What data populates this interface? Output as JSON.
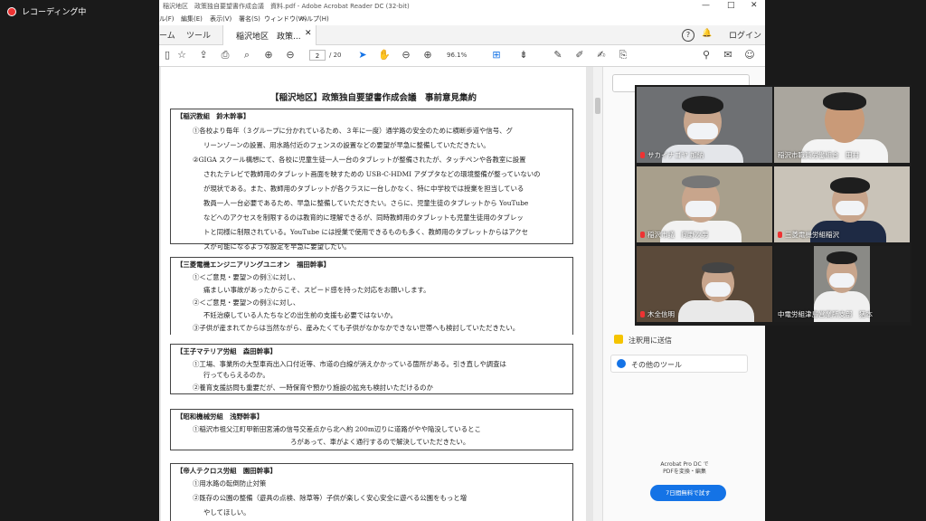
{
  "recording": {
    "label": "レコーディング中"
  },
  "acrobat": {
    "title": "稲沢地区　政策独自要望書作成会議　資料.pdf - Adobe Acrobat Reader DC (32-bit)",
    "window_controls": [
      "—",
      "□",
      "✕"
    ],
    "menu": [
      "ル(F)",
      "編集(E)",
      "表示(V)",
      "署名(S)",
      "ウィンドウ(W)",
      "ヘルプ(H)"
    ],
    "tabs": {
      "home": "ーム",
      "tools": "ツール",
      "document": "稲沢地区　政策..."
    },
    "header_right": {
      "help": "?",
      "login": "ログイン"
    },
    "toolbar": {
      "page_current": "2",
      "page_total": "/ 20",
      "zoom": "96.1%"
    },
    "icons": [
      "star-icon",
      "upload-icon",
      "print-icon",
      "search-icon",
      "page-up-icon",
      "page-down-icon",
      "cursor-icon",
      "hand-icon",
      "zoom-out-icon",
      "zoom-in-icon",
      "comment-icon",
      "pen-icon",
      "sign-icon",
      "share-icon",
      "mail-icon"
    ]
  },
  "document": {
    "title": "【稲沢地区】政策独自要望書作成会議　事前意見集約",
    "sections": [
      {
        "header": "【稲沢教組　鈴木幹事】",
        "lines": [
          "①各校より毎年（３グループに分かれているため、３年に一度）通学路の安全のために横断歩道や信号、グ",
          "リーンゾーンの設置、用水路付近のフェンスの設置などの要望が早急に整備していただきたい。",
          "②GIGA スクール構想にて、各校に児童生徒一人一台のタブレットが整備されたが、タッチペンや各教室に設置",
          "されたテレビで教師用のタブレット画面を映すための USB-C-HDMI アダプタなどの環境整備が整っていないの",
          "が現状である。また、教師用のタブレットが各クラスに一台しかなく、特に中学校では授業を担当している",
          "教員一人一台必要であるため、早急に整備していただきたい。さらに、児童生徒のタブレットから YouTube",
          "などへのアクセスを制限するのは教育的に理解できるが、同時教師用のタブレットも児童生徒用のタブレッ",
          "トと同様に制限されている。YouTube には授業で使用できるものも多く、教師用のタブレットからはアクセ",
          "スが可能になるような設定を早急に要望したい。"
        ]
      },
      {
        "header": "【三菱電機エンジニアリングユニオン　福田幹事】",
        "lines": [
          "①＜ご意見・要望＞の例①に対し、",
          "痛ましい事故があったからこそ、スピード感を持った対応をお願いします。",
          "②＜ご意見・要望＞の例③に対し、",
          "不妊治療している人たちなどの出生前の支援も必要ではないか。",
          "③子供が産まれてからは当然ながら、産みたくても子供がなかなかできない世帯へも検討していただきたい。"
        ]
      },
      {
        "header": "【王子マテリア労組　森田幹事】",
        "lines": [
          "①工場、事業所の大型車両出入口付近等、市道の白線が消えかかっている箇所がある。引き直しや調査は",
          "行ってもらえるのか。",
          "②養育支援訪問も重要だが、一時保育や預かり施設の拡充も検討いただけるのか"
        ]
      },
      {
        "header": "【昭和機械労組　浅野幹事】",
        "lines": [
          "①稲沢市祖父江町甲新田宮浦の信号交差点から北へ約 200m辺りに道路がやや陥没しているとこ",
          "ろがあって、車がよく通行するので解決していただきたい。"
        ]
      },
      {
        "header": "【帝人テクロス労組　園田幹事】",
        "lines": [
          "①用水路の転倒防止対策",
          "②既存の公園の整備（遊具の点検、除草等）子供が楽しく安心安全に遊べる公園をもっと増",
          "やしてほしい。"
        ]
      }
    ]
  },
  "right_panel": {
    "search_placeholder": "",
    "tools": [
      "注釈用に送信",
      "その他のツール"
    ],
    "promo": [
      "Acrobat Pro DC で",
      "PDFを変換・編集"
    ],
    "try_button": "7日間無料で試す"
  },
  "video_participants": [
    {
      "name": "サカイナゴヤ 加納",
      "muted": true
    },
    {
      "name": "稲沢市職員労働組合　田村",
      "muted": false
    },
    {
      "name": "稲沢市議　岡野次男",
      "muted": true
    },
    {
      "name": "三菱電機労組稲沢",
      "muted": true
    },
    {
      "name": "木全信明",
      "muted": true
    },
    {
      "name": "中電労組津島営業所支部　猪本",
      "muted": false
    }
  ],
  "colors": {
    "accent": "#1473e6",
    "mute": "#e33333"
  }
}
